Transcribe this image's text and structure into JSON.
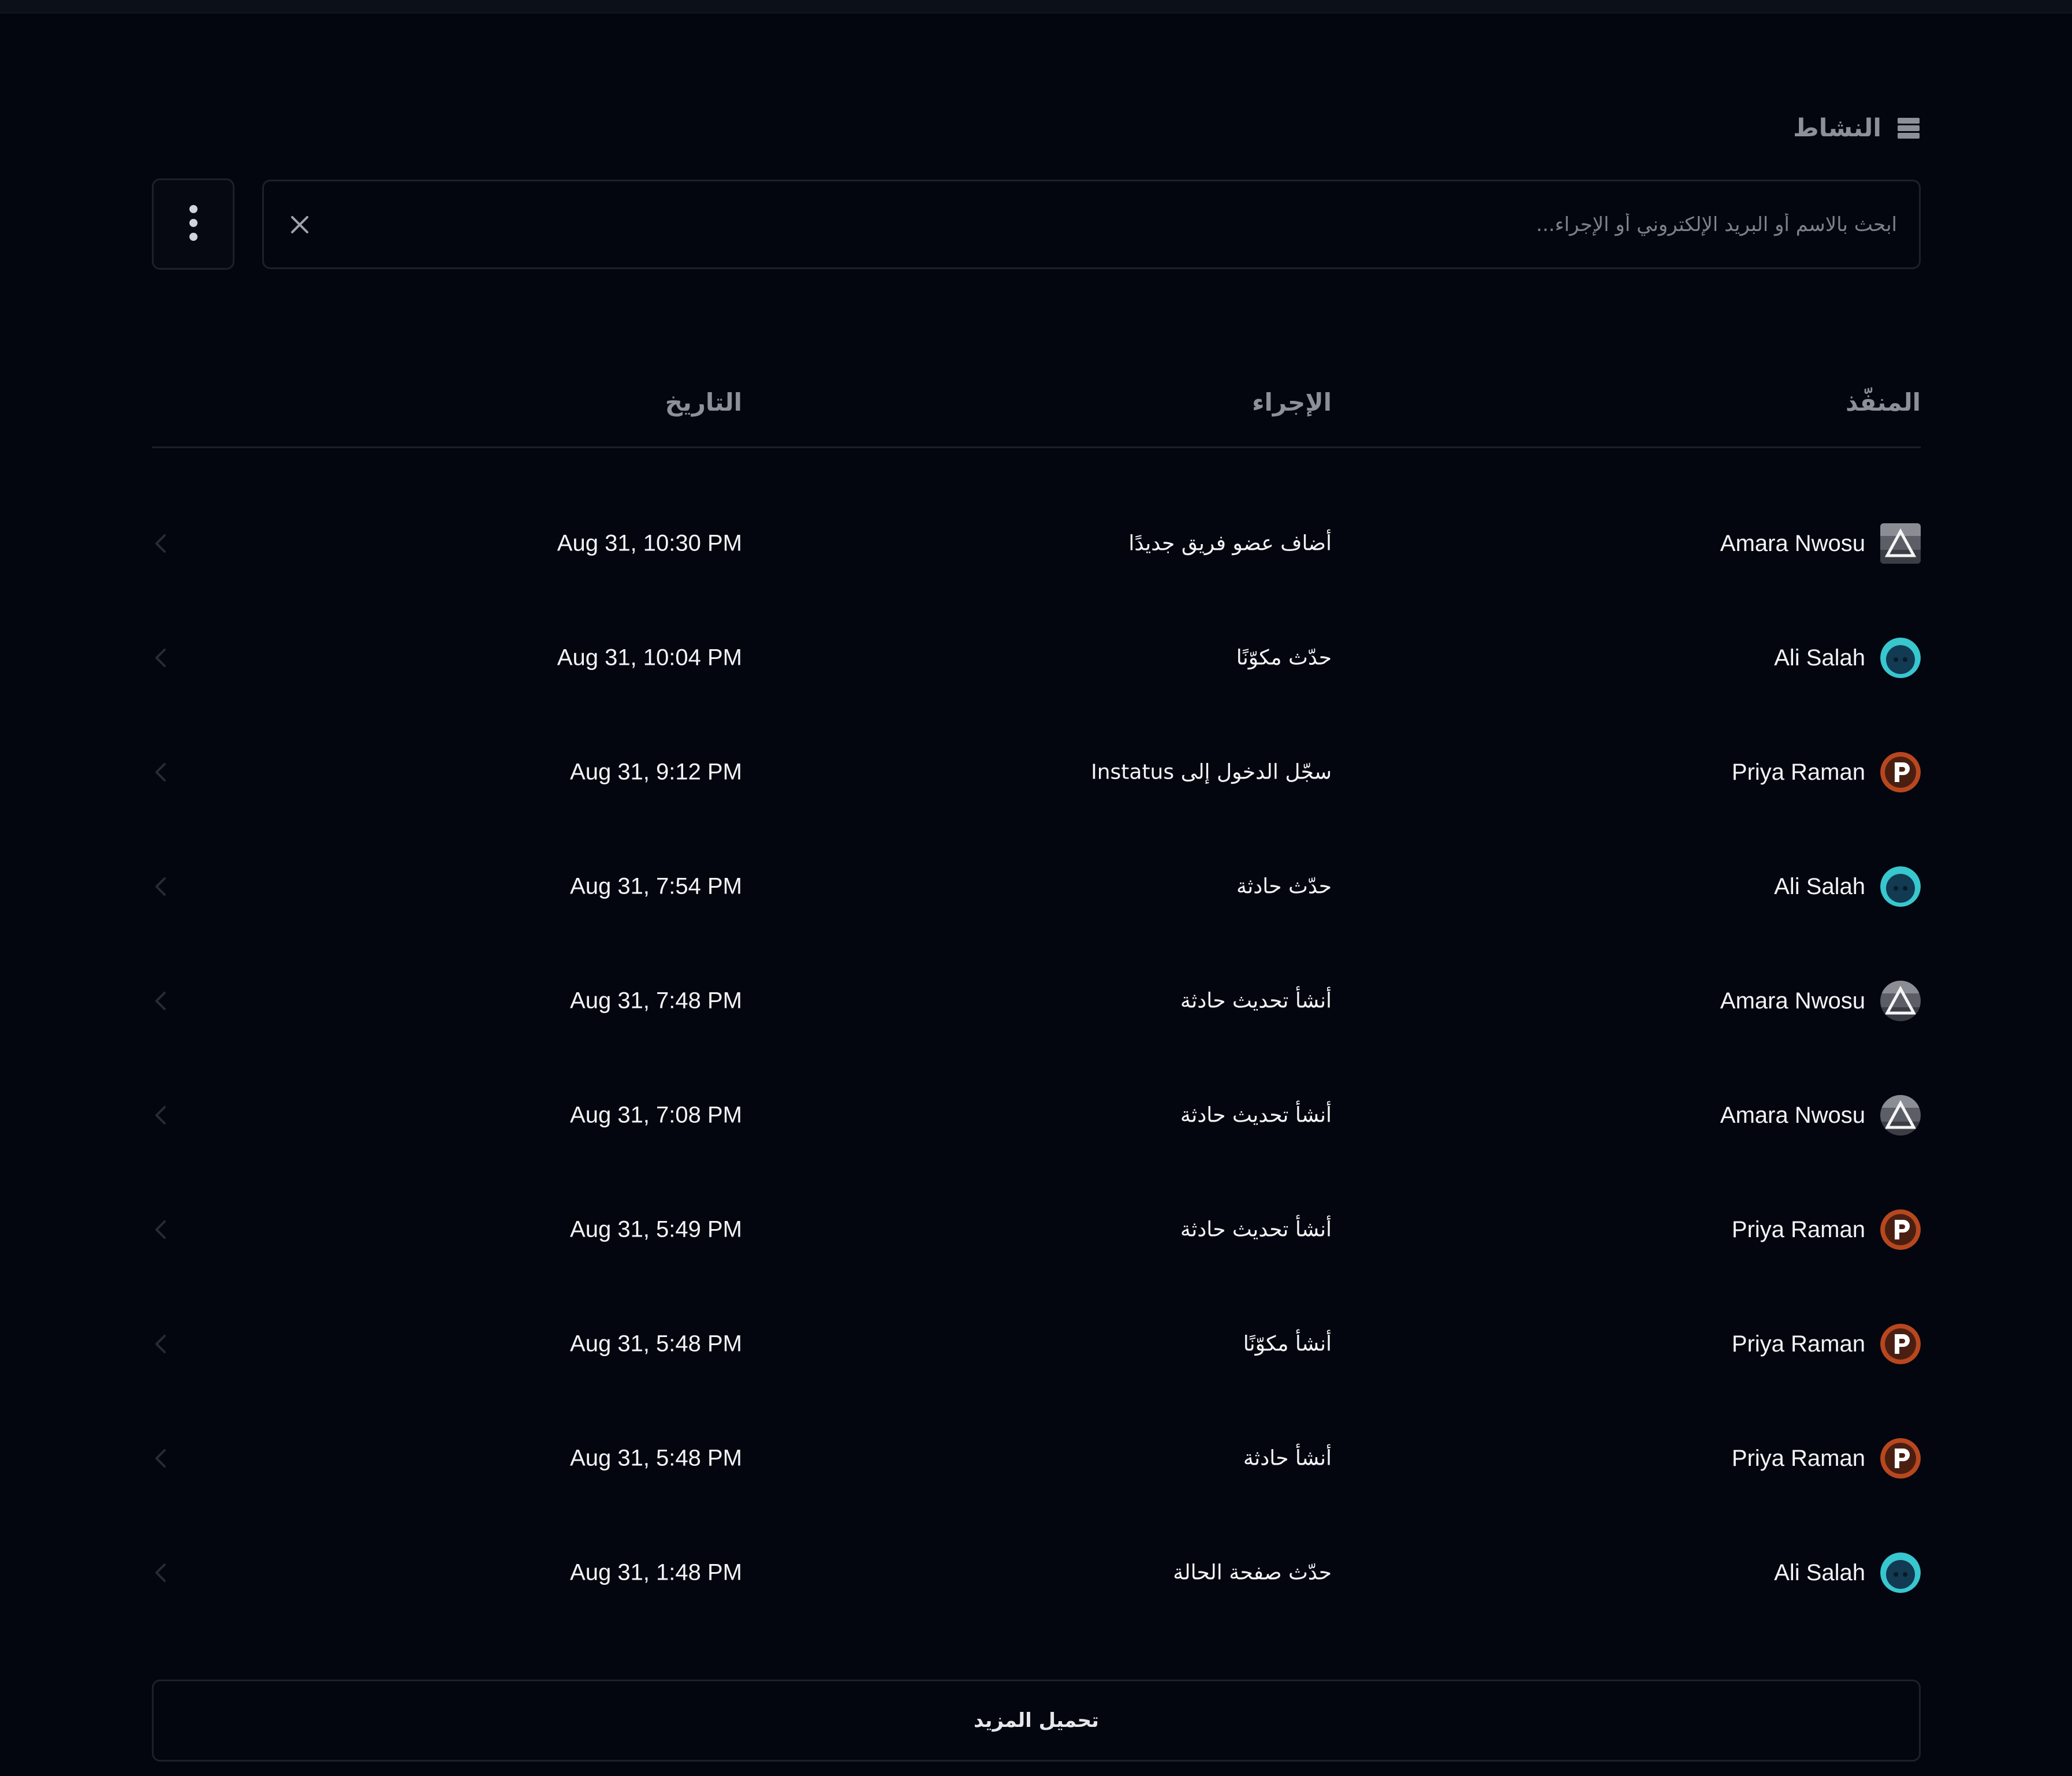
{
  "header": {
    "title": "النشاط",
    "icon": "activity-list-icon"
  },
  "toolbar": {
    "menu_icon": "more-vertical-icon",
    "search_placeholder": "ابحث بالاسم أو البريد الإلكتروني أو الإجراء...",
    "search_value": "",
    "clear_icon": "close-icon"
  },
  "table": {
    "columns": {
      "actor": "المنفّذ",
      "action": "الإجراء",
      "date": "التاريخ"
    },
    "rows": [
      {
        "actor": "Amara Nwosu",
        "avatar": "triangle-photo",
        "action": "أضاف عضو فريق جديدًا",
        "date": "Aug 31, 10:30 PM"
      },
      {
        "actor": "Ali Salah",
        "avatar": "cyan-face",
        "action": "حدّث مكوّنًا",
        "date": "Aug 31, 10:04 PM"
      },
      {
        "actor": "Priya Raman",
        "avatar": "p-logo",
        "action": "سجّل الدخول إلى Instatus",
        "date": "Aug 31, 9:12 PM"
      },
      {
        "actor": "Ali Salah",
        "avatar": "cyan-face",
        "action": "حدّث حادثة",
        "date": "Aug 31, 7:54 PM"
      },
      {
        "actor": "Amara Nwosu",
        "avatar": "triangle-photo",
        "action": "أنشأ تحديث حادثة",
        "date": "Aug 31, 7:48 PM"
      },
      {
        "actor": "Amara Nwosu",
        "avatar": "triangle-photo",
        "action": "أنشأ تحديث حادثة",
        "date": "Aug 31, 7:08 PM"
      },
      {
        "actor": "Priya Raman",
        "avatar": "p-logo",
        "action": "أنشأ تحديث حادثة",
        "date": "Aug 31, 5:49 PM"
      },
      {
        "actor": "Priya Raman",
        "avatar": "p-logo",
        "action": "أنشأ مكوّنًا",
        "date": "Aug 31, 5:48 PM"
      },
      {
        "actor": "Priya Raman",
        "avatar": "p-logo",
        "action": "أنشأ حادثة",
        "date": "Aug 31, 5:48 PM"
      },
      {
        "actor": "Ali Salah",
        "avatar": "cyan-face",
        "action": "حدّث صفحة الحالة",
        "date": "Aug 31, 1:48 PM"
      }
    ]
  },
  "load_more_label": "تحميل المزيد",
  "colors": {
    "background": "#03060f",
    "border": "#1b212c",
    "muted_text": "#8b909b",
    "text": "#f3f4f6"
  }
}
